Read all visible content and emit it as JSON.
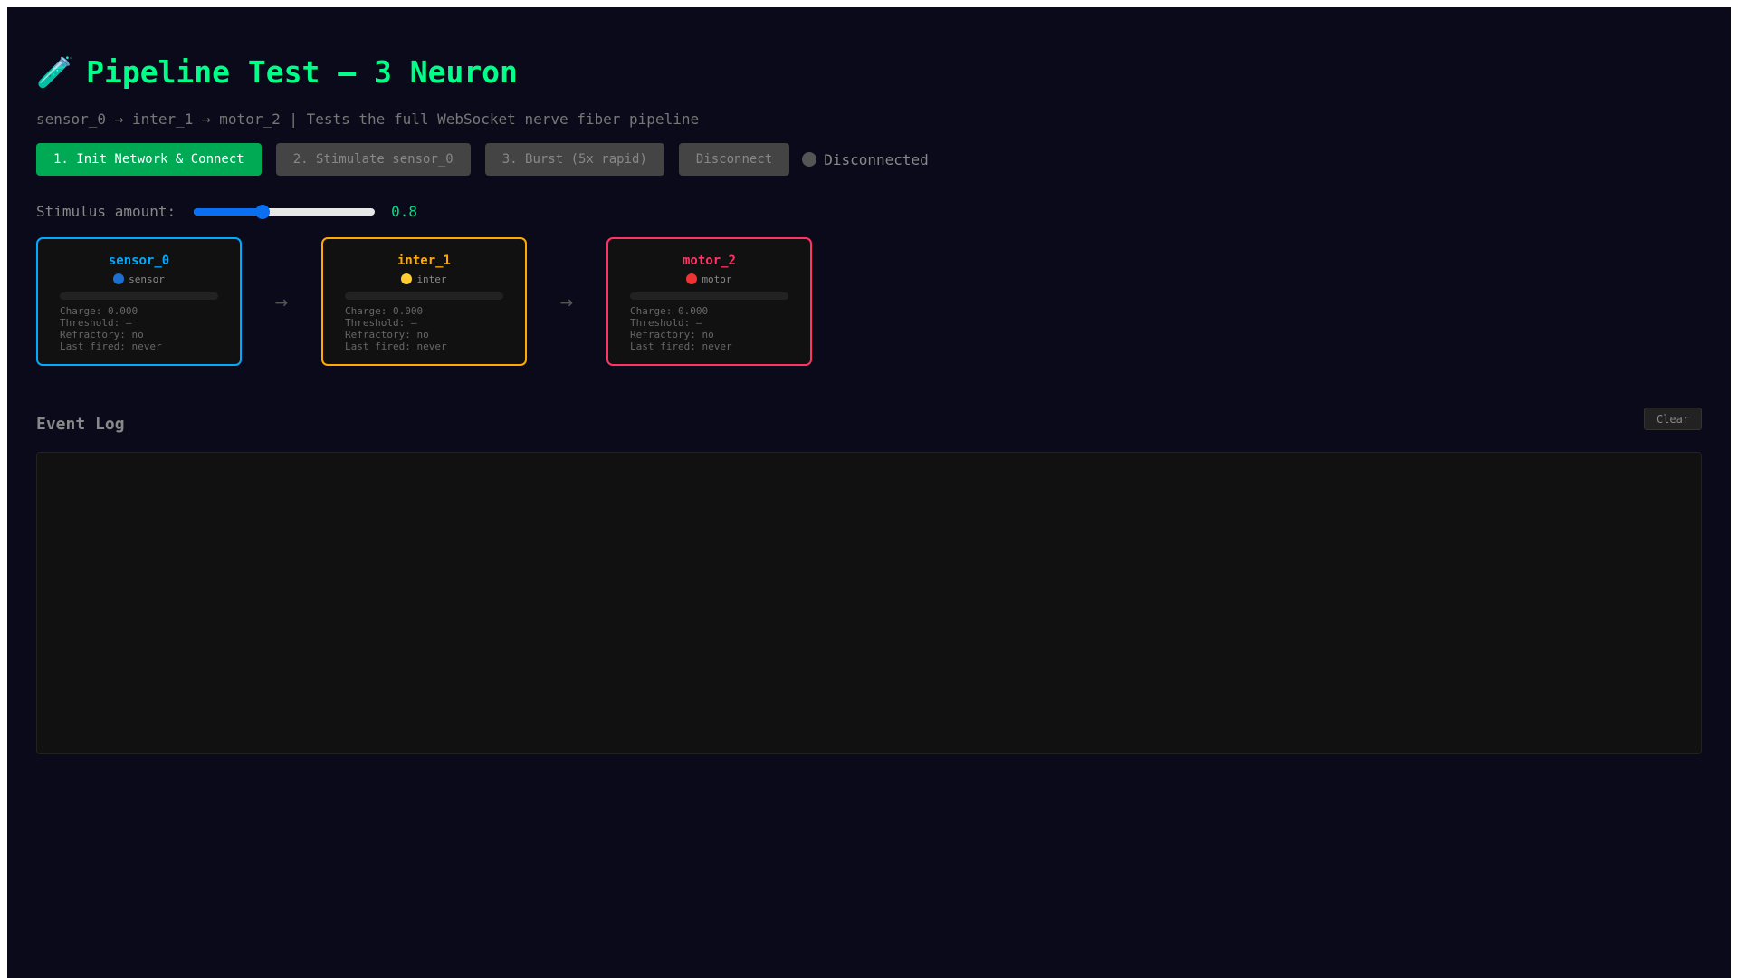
{
  "header": {
    "emoji": "🧪",
    "title": "Pipeline Test — 3 Neuron",
    "subtitle": "sensor_0 → inter_1 → motor_2 | Tests the full WebSocket nerve fiber pipeline"
  },
  "toolbar": {
    "init_label": "1. Init Network & Connect",
    "stimulate_label": "2. Stimulate sensor_0",
    "burst_label": "3. Burst (5x rapid)",
    "disconnect_label": "Disconnect",
    "status": "Disconnected"
  },
  "stimulus": {
    "label": "Stimulus amount:",
    "value": "0.8",
    "fraction": 0.38
  },
  "arrow": "→",
  "neurons": [
    {
      "name": "sensor_0",
      "type": "sensor",
      "color": "#00aaff",
      "dot": "#1a6fd0",
      "charge": "Charge: 0.000",
      "threshold": "Threshold: —",
      "refractory": "Refractory: no",
      "last_fired": "Last fired: never"
    },
    {
      "name": "inter_1",
      "type": "inter",
      "color": "#ffaa00",
      "dot": "#ffcc33",
      "charge": "Charge: 0.000",
      "threshold": "Threshold: —",
      "refractory": "Refractory: no",
      "last_fired": "Last fired: never"
    },
    {
      "name": "motor_2",
      "type": "motor",
      "color": "#ff3366",
      "dot": "#ee3333",
      "charge": "Charge: 0.000",
      "threshold": "Threshold: —",
      "refractory": "Refractory: no",
      "last_fired": "Last fired: never"
    }
  ],
  "log": {
    "title": "Event Log",
    "clear_label": "Clear"
  }
}
